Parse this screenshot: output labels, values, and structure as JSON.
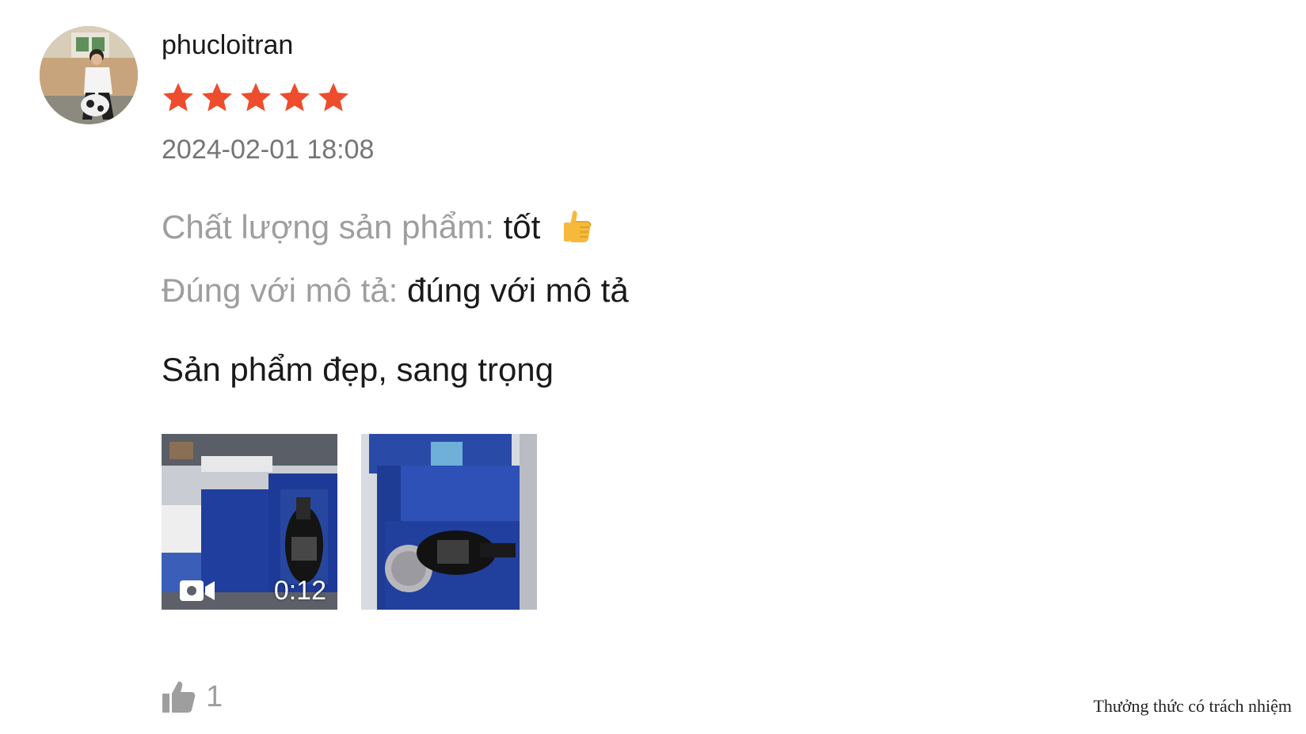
{
  "review": {
    "username": "phucloitran",
    "rating": 5,
    "rating_max": 5,
    "timestamp": "2024-02-01 18:08",
    "attributes": [
      {
        "label": "Chất lượng sản phẩm:",
        "value": "tốt",
        "icon": "thumbs-up-emoji"
      },
      {
        "label": "Đúng với mô tả:",
        "value": "đúng với mô tả"
      }
    ],
    "comment": "Sản phẩm đẹp, sang trọng",
    "media": [
      {
        "type": "video",
        "duration": "0:12",
        "icon": "video-camera-icon"
      },
      {
        "type": "image"
      }
    ],
    "likes": {
      "count": "1",
      "icon": "thumbs-up-icon"
    }
  },
  "footer": {
    "note": "Thưởng thức có trách nhiệm"
  },
  "colors": {
    "star": "#ee4d2d",
    "label": "#9e9e9e",
    "timestamp": "#757575",
    "text": "#1a1a1a"
  }
}
